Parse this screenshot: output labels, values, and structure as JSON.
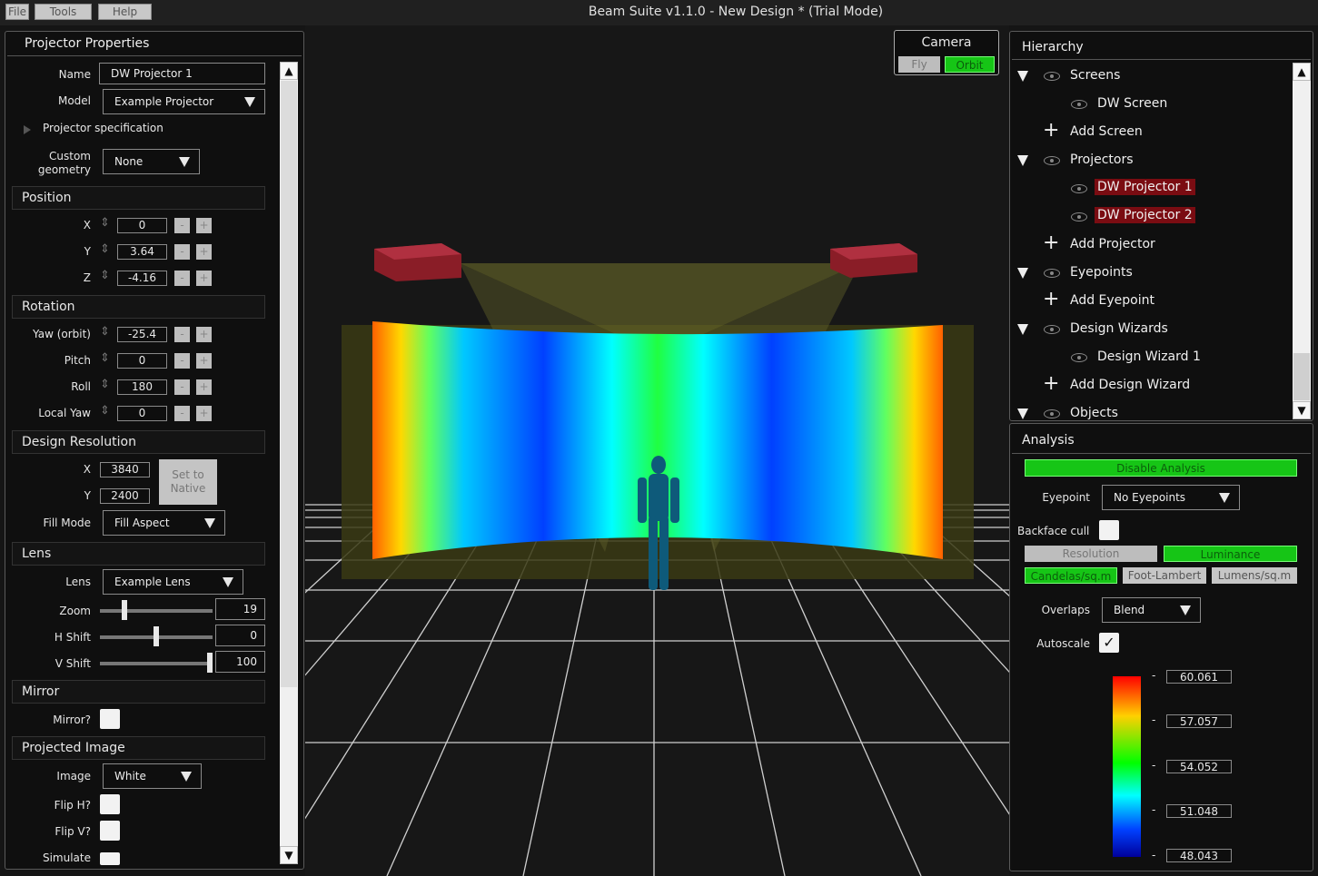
{
  "menu": {
    "file": "File",
    "tools": "Tools",
    "help": "Help"
  },
  "window_title": "Beam Suite v1.1.0 - New Design *  (Trial Mode)",
  "projector_panel": {
    "title": "Projector Properties",
    "name_label": "Name",
    "name_value": "DW Projector 1",
    "model_label": "Model",
    "model_value": "Example Projector",
    "spec_label": "Projector specification",
    "custom_geometry_label_1": "Custom",
    "custom_geometry_label_2": "geometry",
    "custom_geometry_value": "None",
    "position": {
      "title": "Position",
      "x_label": "X",
      "x": "0",
      "y_label": "Y",
      "y": "3.64",
      "z_label": "Z",
      "z": "-4.16"
    },
    "rotation": {
      "title": "Rotation",
      "yaw_label": "Yaw (orbit)",
      "yaw": "-25.4",
      "pitch_label": "Pitch",
      "pitch": "0",
      "roll_label": "Roll",
      "roll": "180",
      "local_yaw_label": "Local Yaw",
      "local_yaw": "0"
    },
    "design_resolution": {
      "title": "Design Resolution",
      "x_label": "X",
      "x": "3840",
      "y_label": "Y",
      "y": "2400",
      "set_native_1": "Set to",
      "set_native_2": "Native",
      "fill_mode_label": "Fill Mode",
      "fill_mode_value": "Fill Aspect"
    },
    "lens": {
      "title": "Lens",
      "lens_label": "Lens",
      "lens_value": "Example Lens",
      "zoom_label": "Zoom",
      "zoom": "19",
      "zoom_frac": 0.2,
      "hshift_label": "H Shift",
      "hshift": "0",
      "hshift_frac": 0.5,
      "vshift_label": "V Shift",
      "vshift": "100",
      "vshift_frac": 1.0
    },
    "mirror": {
      "title": "Mirror",
      "mirror_label": "Mirror?"
    },
    "projected_image": {
      "title": "Projected Image",
      "image_label": "Image",
      "image_value": "White",
      "fliph_label": "Flip H?",
      "flipv_label": "Flip V?",
      "simulate_label": "Simulate"
    },
    "minus": "-",
    "plus": "+",
    "scroll_up": "▲",
    "scroll_down": "▼"
  },
  "camera": {
    "title": "Camera",
    "fly": "Fly",
    "orbit": "Orbit"
  },
  "hierarchy": {
    "title": "Hierarchy",
    "items": [
      {
        "label": "Screens"
      },
      {
        "label": "DW Screen"
      },
      {
        "label": "Add Screen"
      },
      {
        "label": "Projectors"
      },
      {
        "label": "DW Projector 1"
      },
      {
        "label": "DW Projector 2"
      },
      {
        "label": "Add Projector"
      },
      {
        "label": "Eyepoints"
      },
      {
        "label": "Add Eyepoint"
      },
      {
        "label": "Design Wizards"
      },
      {
        "label": "Design Wizard 1"
      },
      {
        "label": "Add Design Wizard"
      },
      {
        "label": "Objects"
      }
    ]
  },
  "analysis": {
    "title": "Analysis",
    "disable": "Disable Analysis",
    "eyepoint_label": "Eyepoint",
    "eyepoint_value": "No Eyepoints",
    "backface_label": "Backface cull",
    "resolution": "Resolution",
    "luminance": "Luminance",
    "candelas": "Candelas/sq.m",
    "foot_lambert": "Foot-Lambert",
    "lumens": "Lumens/sq.m",
    "overlaps_label": "Overlaps",
    "overlaps_value": "Blend",
    "autoscale_label": "Autoscale",
    "checkmark": "✓",
    "legend": [
      "60.061",
      "57.057",
      "54.052",
      "51.048",
      "48.043"
    ],
    "tick": "-"
  },
  "colors": {
    "selected_bg": "#7a0c12",
    "active_green": "#16c516",
    "panel_bg": "#0f0f0f",
    "projector_red": "#8a1d27"
  }
}
